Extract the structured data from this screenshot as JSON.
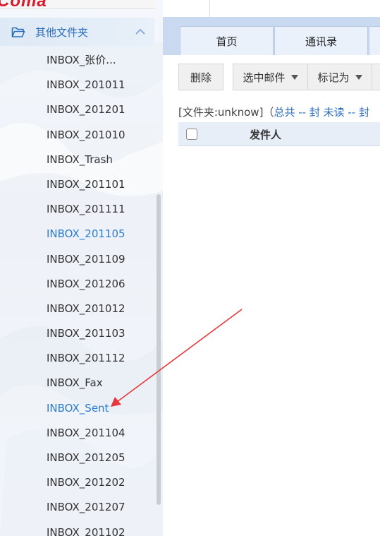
{
  "sidebar": {
    "logo_text": "Coma",
    "group_label": "其他文件夹",
    "folders": [
      {
        "label": "INBOX_张价...",
        "highlight": false
      },
      {
        "label": "INBOX_201011",
        "highlight": false
      },
      {
        "label": "INBOX_201201",
        "highlight": false
      },
      {
        "label": "INBOX_201010",
        "highlight": false
      },
      {
        "label": "INBOX_Trash",
        "highlight": false
      },
      {
        "label": "INBOX_201101",
        "highlight": false
      },
      {
        "label": "INBOX_201111",
        "highlight": false
      },
      {
        "label": "INBOX_201105",
        "highlight": true
      },
      {
        "label": "INBOX_201109",
        "highlight": false
      },
      {
        "label": "INBOX_201206",
        "highlight": false
      },
      {
        "label": "INBOX_201012",
        "highlight": false
      },
      {
        "label": "INBOX_201103",
        "highlight": false
      },
      {
        "label": "INBOX_201112",
        "highlight": false
      },
      {
        "label": "INBOX_Fax",
        "highlight": false
      },
      {
        "label": "INBOX_Sent",
        "highlight": true
      },
      {
        "label": "INBOX_201104",
        "highlight": false
      },
      {
        "label": "INBOX_201205",
        "highlight": false
      },
      {
        "label": "INBOX_201202",
        "highlight": false
      },
      {
        "label": "INBOX_201207",
        "highlight": false
      },
      {
        "label": "INBOX_201102",
        "highlight": false
      }
    ]
  },
  "tabs": {
    "home": "首页",
    "contacts": "通讯录"
  },
  "toolbar": {
    "delete": "删除",
    "select_mail": "选中邮件",
    "mark_as": "标记为"
  },
  "info": {
    "folder_prefix": "[文件夹:",
    "folder_name": "unknow",
    "folder_suffix": "]",
    "paren_open": "（",
    "total": "总共",
    "sep1": " -- ",
    "feng1": "封",
    "unread": " 未读",
    "sep2": " -- ",
    "feng2": "封"
  },
  "table": {
    "sender_header": "发件人"
  },
  "colors": {
    "accent_blue": "#2a6ebb",
    "link_blue": "#2a7ccf",
    "annotation_red": "#e8373a",
    "logo_red": "#d9182a"
  }
}
